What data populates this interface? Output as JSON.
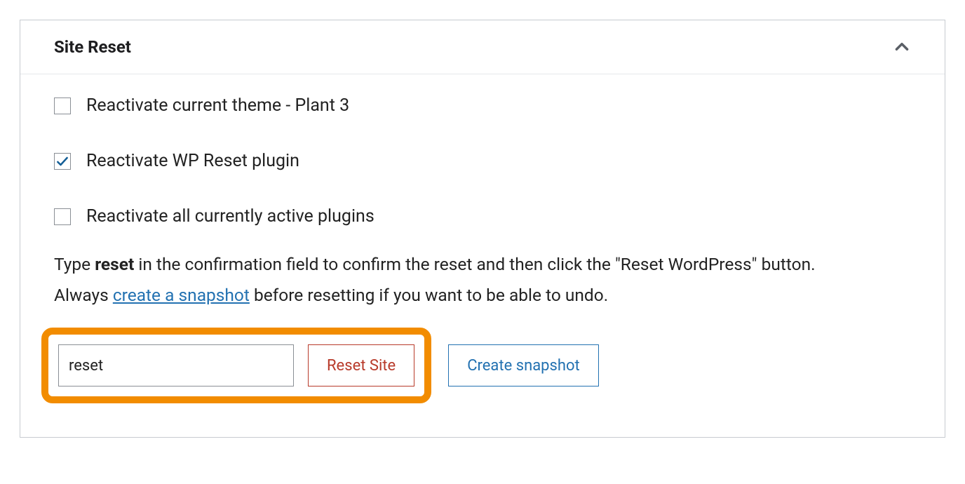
{
  "panel": {
    "title": "Site Reset",
    "collapsed": false
  },
  "checkboxes": [
    {
      "label": "Reactivate current theme - Plant 3",
      "checked": false
    },
    {
      "label": "Reactivate WP Reset plugin",
      "checked": true
    },
    {
      "label": "Reactivate all currently active plugins",
      "checked": false
    }
  ],
  "instructions": {
    "line1_prefix": "Type ",
    "line1_bold": "reset",
    "line1_suffix": " in the confirmation field to confirm the reset and then click the \"Reset WordPress\" button.",
    "line2_prefix": "Always ",
    "line2_link": "create a snapshot",
    "line2_suffix": " before resetting if you want to be able to undo."
  },
  "confirm": {
    "value": "reset"
  },
  "buttons": {
    "reset_site": "Reset Site",
    "create_snapshot": "Create snapshot"
  },
  "colors": {
    "highlight": "#f28c00",
    "link": "#2271b1",
    "danger": "#b83a2a",
    "border": "#c7cbd0"
  }
}
